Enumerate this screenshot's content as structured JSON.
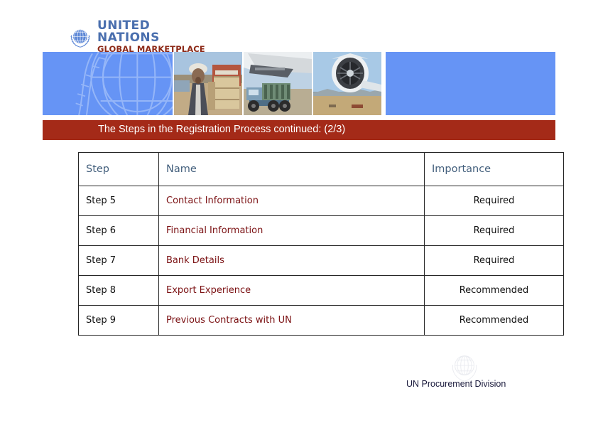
{
  "logo": {
    "emblem_icon": "un-emblem-icon",
    "line1": "UNITED NATIONS",
    "line2": "GLOBAL MARKETPLACE",
    "line1_color": "#4a6fae",
    "line2_color": "#8d2a18"
  },
  "banner": {
    "panel_color": "#6694f5",
    "watermark_icon": "un-globe-watermark-icon",
    "photos": [
      {
        "name": "photo-man-with-crates",
        "alt": "Man in turban standing beside stacked aid crates"
      },
      {
        "name": "photo-truck-and-cargo-plane",
        "alt": "Cargo truck being loaded under a transport aircraft wing"
      },
      {
        "name": "photo-jet-engine",
        "alt": "Close-up of an aircraft jet engine over an airfield"
      }
    ]
  },
  "title_bar": {
    "text": "The Steps in the Registration Process continued: (2/3)",
    "background_color": "#a42a18",
    "text_color": "#ffffff"
  },
  "table": {
    "headers": [
      "Step",
      "Name",
      "Importance"
    ],
    "header_color": "#44607d",
    "name_color": "#7b1113",
    "rows": [
      {
        "step": "Step 5",
        "name": "Contact Information",
        "importance": "Required"
      },
      {
        "step": "Step 6",
        "name": "Financial Information",
        "importance": "Required"
      },
      {
        "step": "Step 7",
        "name": "Bank Details",
        "importance": "Required"
      },
      {
        "step": "Step 8",
        "name": "Export Experience",
        "importance": "Recommended"
      },
      {
        "step": "Step 9",
        "name": "Previous Contracts with UN",
        "importance": "Recommended"
      }
    ]
  },
  "footer": {
    "watermark_icon": "un-emblem-watermark-icon",
    "text": "UN Procurement Division"
  }
}
